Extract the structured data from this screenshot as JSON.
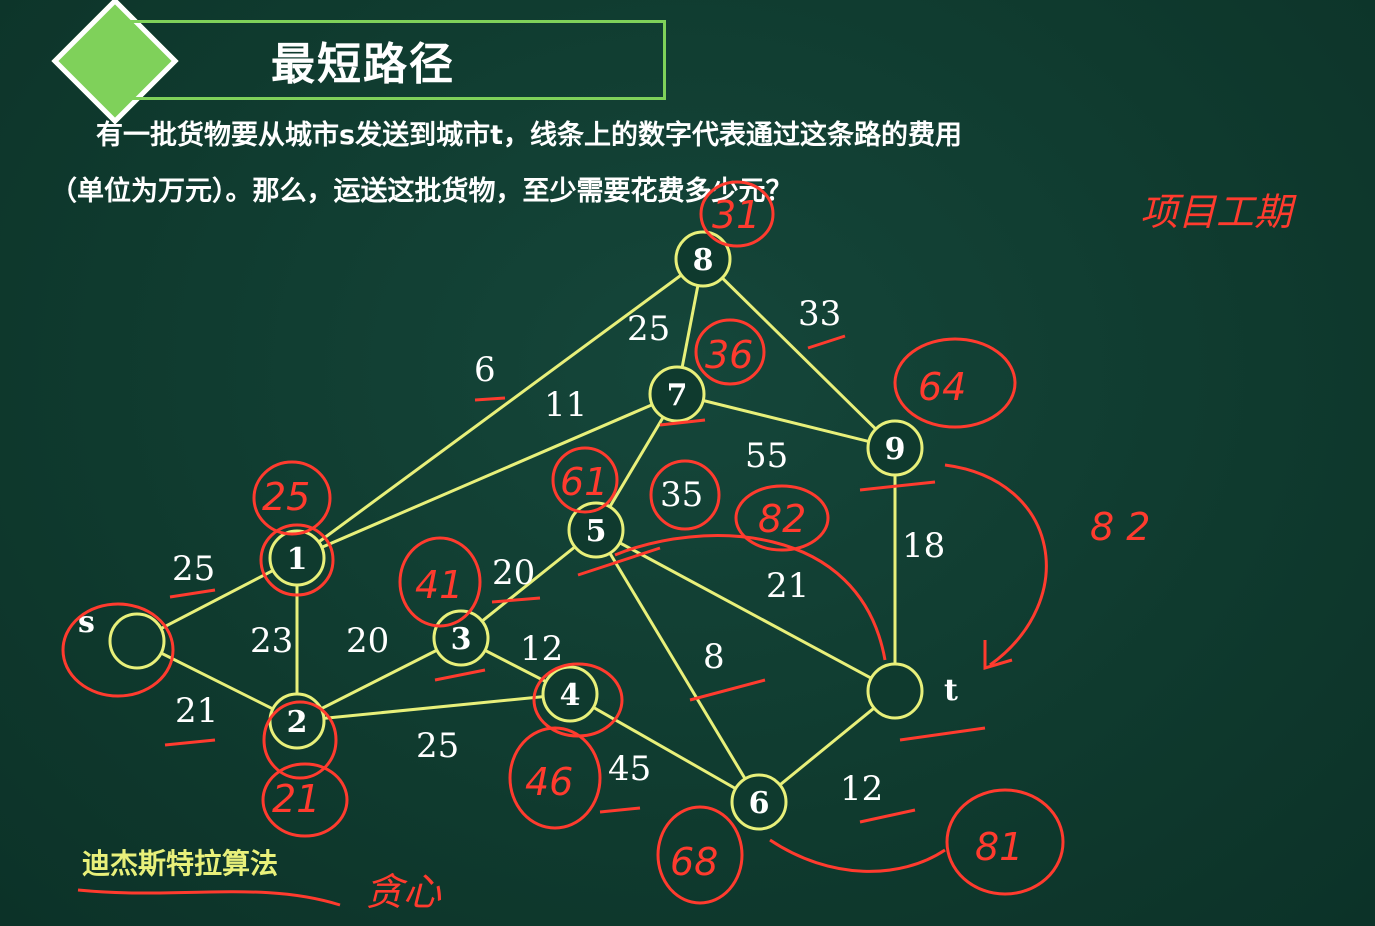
{
  "header": {
    "title": "最短路径"
  },
  "problem": {
    "line1": "有一批货物要从城市s发送到城市t，线条上的数字代表通过这条路的费用",
    "line2": "（单位为万元）。那么，运送这批货物，至少需要花费多少元？"
  },
  "footer": {
    "algorithm_label": "迪杰斯特拉算法"
  },
  "graph": {
    "nodes": [
      {
        "id": "s",
        "label": "",
        "outside_label": "s"
      },
      {
        "id": "1",
        "label": "1"
      },
      {
        "id": "2",
        "label": "2"
      },
      {
        "id": "3",
        "label": "3"
      },
      {
        "id": "4",
        "label": "4"
      },
      {
        "id": "5",
        "label": "5"
      },
      {
        "id": "6",
        "label": "6"
      },
      {
        "id": "7",
        "label": "7"
      },
      {
        "id": "8",
        "label": "8"
      },
      {
        "id": "9",
        "label": "9"
      },
      {
        "id": "t",
        "label": "",
        "outside_label": "t"
      }
    ],
    "edges": [
      {
        "from": "s",
        "to": "1",
        "weight": "25"
      },
      {
        "from": "s",
        "to": "2",
        "weight": "21"
      },
      {
        "from": "1",
        "to": "2",
        "weight": "23"
      },
      {
        "from": "1",
        "to": "8",
        "weight": "6"
      },
      {
        "from": "1",
        "to": "7",
        "weight": "11"
      },
      {
        "from": "2",
        "to": "3",
        "weight": "20"
      },
      {
        "from": "2",
        "to": "4",
        "weight": "25"
      },
      {
        "from": "3",
        "to": "5",
        "weight": "20"
      },
      {
        "from": "3",
        "to": "4",
        "weight": "12"
      },
      {
        "from": "4",
        "to": "6",
        "weight": "45"
      },
      {
        "from": "5",
        "to": "7",
        "weight": "35"
      },
      {
        "from": "5",
        "to": "6",
        "weight": "8"
      },
      {
        "from": "5",
        "to": "t",
        "weight": "21"
      },
      {
        "from": "6",
        "to": "t",
        "weight": "12"
      },
      {
        "from": "7",
        "to": "8",
        "weight": "25"
      },
      {
        "from": "7",
        "to": "9",
        "weight": "55"
      },
      {
        "from": "8",
        "to": "9",
        "weight": "33"
      },
      {
        "from": "9",
        "to": "t",
        "weight": "18"
      }
    ],
    "colors": {
      "edge": "#e8f07a",
      "node_stroke": "#e8f07a",
      "annotation": "#ff3b2e",
      "title_accent": "#7fd15a"
    }
  },
  "annotations": {
    "handwritten_values": [
      "25",
      "21",
      "41",
      "46",
      "61",
      "68",
      "36",
      "31",
      "64",
      "82",
      "81"
    ],
    "side_note": "8 2",
    "project_note": "项目工期",
    "greedy_note": "贪心"
  }
}
